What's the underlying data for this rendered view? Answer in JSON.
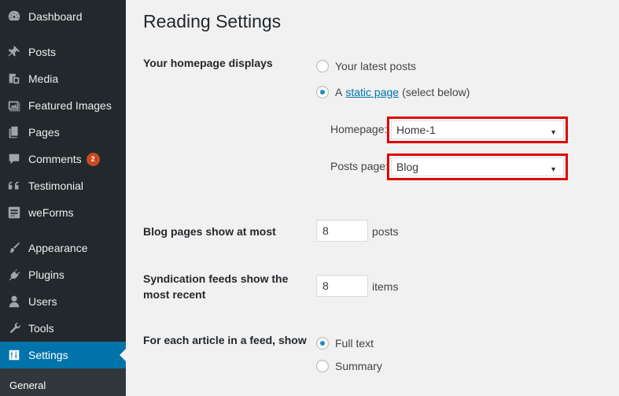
{
  "sidebar": {
    "items": [
      {
        "label": "Dashboard",
        "icon": "dashboard-icon"
      },
      {
        "label": "Posts",
        "icon": "pushpin-icon"
      },
      {
        "label": "Media",
        "icon": "media-icon"
      },
      {
        "label": "Featured Images",
        "icon": "images-icon"
      },
      {
        "label": "Pages",
        "icon": "pages-icon"
      },
      {
        "label": "Comments",
        "icon": "comment-icon",
        "badge": "2"
      },
      {
        "label": "Testimonial",
        "icon": "quote-icon"
      },
      {
        "label": "weForms",
        "icon": "weforms-icon"
      },
      {
        "label": "Appearance",
        "icon": "brush-icon"
      },
      {
        "label": "Plugins",
        "icon": "plugin-icon"
      },
      {
        "label": "Users",
        "icon": "user-icon"
      },
      {
        "label": "Tools",
        "icon": "wrench-icon"
      },
      {
        "label": "Settings",
        "icon": "settings-icon",
        "active": true
      }
    ],
    "submenu": {
      "label": "General"
    }
  },
  "colors": {
    "sidebar_bg": "#23282d",
    "active_bg": "#0073aa",
    "badge_bg": "#ca4a1f",
    "highlight_border": "#e00000",
    "link": "#0073aa"
  },
  "main": {
    "title": "Reading Settings",
    "homepage_displays": {
      "label": "Your homepage displays",
      "option_latest": "Your latest posts",
      "option_static_prefix": "A",
      "option_static_link": "static page",
      "option_static_suffix": "(select below)",
      "selected": "static",
      "homepage_label": "Homepage:",
      "homepage_value": "Home-1",
      "posts_page_label": "Posts page:",
      "posts_page_value": "Blog"
    },
    "blog_pages": {
      "label": "Blog pages show at most",
      "value": "8",
      "suffix": "posts"
    },
    "syndication": {
      "label_line1": "Syndication feeds show the",
      "label_line2": "most recent",
      "value": "8",
      "suffix": "items"
    },
    "feed_article": {
      "label": "For each article in a feed, show",
      "option_full": "Full text",
      "option_summary": "Summary",
      "selected": "full"
    }
  }
}
